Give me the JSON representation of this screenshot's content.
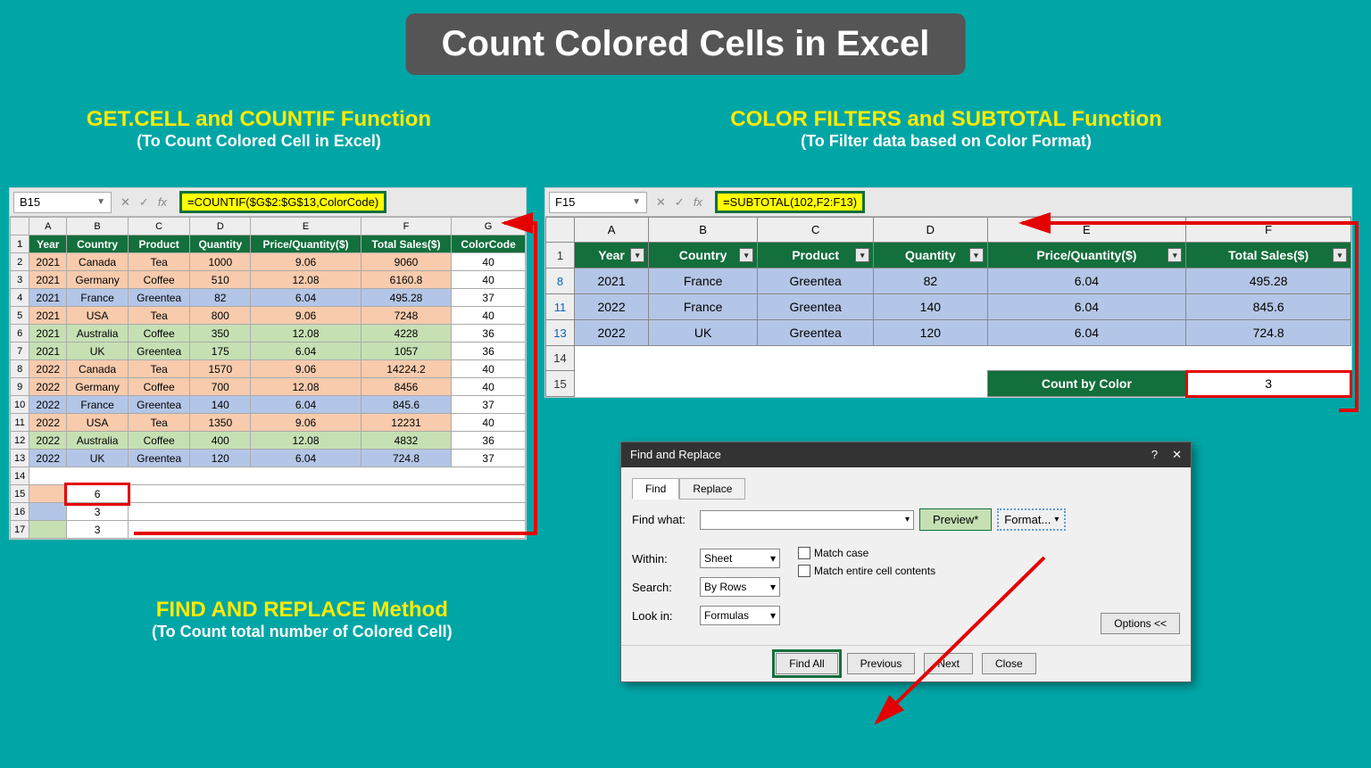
{
  "title": "Count Colored Cells in Excel",
  "panels": {
    "left": {
      "heading": "GET.CELL and COUNTIF Function",
      "sub": "(To Count Colored Cell in Excel)"
    },
    "right": {
      "heading": "COLOR FILTERS and SUBTOTAL Function",
      "sub": "(To Filter data based on Color Format)"
    },
    "bottom": {
      "heading": "FIND AND REPLACE Method",
      "sub": "(To Count total number of Colored Cell)"
    }
  },
  "left": {
    "namebox": "B15",
    "formula": "=COUNTIF($G$2:$G$13,ColorCode)",
    "cols": [
      "A",
      "B",
      "C",
      "D",
      "E",
      "F",
      "G"
    ],
    "headers": [
      "Year",
      "Country",
      "Product",
      "Quantity",
      "Price/Quantity($)",
      "Total Sales($)",
      "ColorCode"
    ],
    "rows": [
      {
        "n": 2,
        "c": "c-orange",
        "d": [
          "2021",
          "Canada",
          "Tea",
          "1000",
          "9.06",
          "9060",
          "40"
        ]
      },
      {
        "n": 3,
        "c": "c-orange",
        "d": [
          "2021",
          "Germany",
          "Coffee",
          "510",
          "12.08",
          "6160.8",
          "40"
        ]
      },
      {
        "n": 4,
        "c": "c-blue",
        "d": [
          "2021",
          "France",
          "Greentea",
          "82",
          "6.04",
          "495.28",
          "37"
        ]
      },
      {
        "n": 5,
        "c": "c-orange",
        "d": [
          "2021",
          "USA",
          "Tea",
          "800",
          "9.06",
          "7248",
          "40"
        ]
      },
      {
        "n": 6,
        "c": "c-green",
        "d": [
          "2021",
          "Australia",
          "Coffee",
          "350",
          "12.08",
          "4228",
          "36"
        ]
      },
      {
        "n": 7,
        "c": "c-green",
        "d": [
          "2021",
          "UK",
          "Greentea",
          "175",
          "6.04",
          "1057",
          "36"
        ]
      },
      {
        "n": 8,
        "c": "c-orange",
        "d": [
          "2022",
          "Canada",
          "Tea",
          "1570",
          "9.06",
          "14224.2",
          "40"
        ]
      },
      {
        "n": 9,
        "c": "c-orange",
        "d": [
          "2022",
          "Germany",
          "Coffee",
          "700",
          "12.08",
          "8456",
          "40"
        ]
      },
      {
        "n": 10,
        "c": "c-blue",
        "d": [
          "2022",
          "France",
          "Greentea",
          "140",
          "6.04",
          "845.6",
          "37"
        ]
      },
      {
        "n": 11,
        "c": "c-orange",
        "d": [
          "2022",
          "USA",
          "Tea",
          "1350",
          "9.06",
          "12231",
          "40"
        ]
      },
      {
        "n": 12,
        "c": "c-green",
        "d": [
          "2022",
          "Australia",
          "Coffee",
          "400",
          "12.08",
          "4832",
          "36"
        ]
      },
      {
        "n": 13,
        "c": "c-blue",
        "d": [
          "2022",
          "UK",
          "Greentea",
          "120",
          "6.04",
          "724.8",
          "37"
        ]
      }
    ],
    "results": {
      "r15": "6",
      "r16": "3",
      "r17": "3"
    }
  },
  "right": {
    "namebox": "F15",
    "formula": "=SUBTOTAL(102,F2:F13)",
    "cols": [
      "A",
      "B",
      "C",
      "D",
      "E",
      "F"
    ],
    "headers": [
      "Year",
      "Country",
      "Product",
      "Quantity",
      "Price/Quantity($)",
      "Total Sales($)"
    ],
    "rows": [
      {
        "n": 8,
        "d": [
          "2021",
          "France",
          "Greentea",
          "82",
          "6.04",
          "495.28"
        ]
      },
      {
        "n": 11,
        "d": [
          "2022",
          "France",
          "Greentea",
          "140",
          "6.04",
          "845.6"
        ]
      },
      {
        "n": 13,
        "d": [
          "2022",
          "UK",
          "Greentea",
          "120",
          "6.04",
          "724.8"
        ]
      }
    ],
    "count_label": "Count by Color",
    "count_value": "3"
  },
  "dialog": {
    "title": "Find and Replace",
    "tabs": [
      "Find",
      "Replace"
    ],
    "find_what": "Find what:",
    "preview": "Preview*",
    "format": "Format...",
    "within": {
      "label": "Within:",
      "value": "Sheet"
    },
    "search": {
      "label": "Search:",
      "value": "By Rows"
    },
    "lookin": {
      "label": "Look in:",
      "value": "Formulas"
    },
    "match_case": "Match case",
    "match_contents": "Match entire cell contents",
    "options": "Options <<",
    "buttons": [
      "Find All",
      "Previous",
      "Next",
      "Close"
    ]
  }
}
